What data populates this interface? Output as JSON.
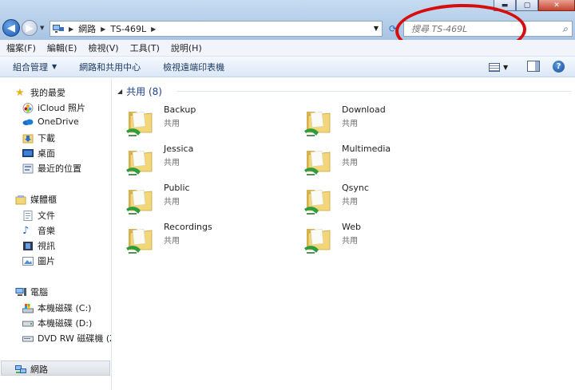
{
  "window": {
    "min_label": "▬",
    "max_label": "▢",
    "close_label": "✕"
  },
  "address": {
    "breadcrumbs": [
      "網路",
      "TS-469L"
    ]
  },
  "search": {
    "placeholder": "搜尋 TS-469L"
  },
  "menubar": {
    "items": [
      "檔案(F)",
      "編輯(E)",
      "檢視(V)",
      "工具(T)",
      "說明(H)"
    ]
  },
  "toolbar": {
    "organize_label": "組合管理",
    "network_center_label": "網路和共用中心",
    "printers_label": "檢視遠端印表機"
  },
  "sidebar": {
    "favorites": {
      "label": "我的最愛",
      "items": [
        "iCloud 照片",
        "OneDrive",
        "下載",
        "桌面",
        "最近的位置"
      ]
    },
    "libraries": {
      "label": "媒體櫃",
      "items": [
        "文件",
        "音樂",
        "視訊",
        "圖片"
      ]
    },
    "computer": {
      "label": "電腦",
      "items": [
        "本機磁碟 (C:)",
        "本機磁碟 (D:)",
        "DVD RW 磁碟機 (Z:)"
      ]
    },
    "network": {
      "label": "網路"
    }
  },
  "content": {
    "group_label": "共用 (8)",
    "folders": [
      {
        "name": "Backup",
        "type": "共用"
      },
      {
        "name": "Download",
        "type": "共用"
      },
      {
        "name": "Jessica",
        "type": "共用"
      },
      {
        "name": "Multimedia",
        "type": "共用"
      },
      {
        "name": "Public",
        "type": "共用"
      },
      {
        "name": "Qsync",
        "type": "共用"
      },
      {
        "name": "Recordings",
        "type": "共用"
      },
      {
        "name": "Web",
        "type": "共用"
      }
    ]
  },
  "colors": {
    "annotation": "#d60d0d",
    "folder": "#f3d57a",
    "share_green": "#2e9e3c"
  }
}
